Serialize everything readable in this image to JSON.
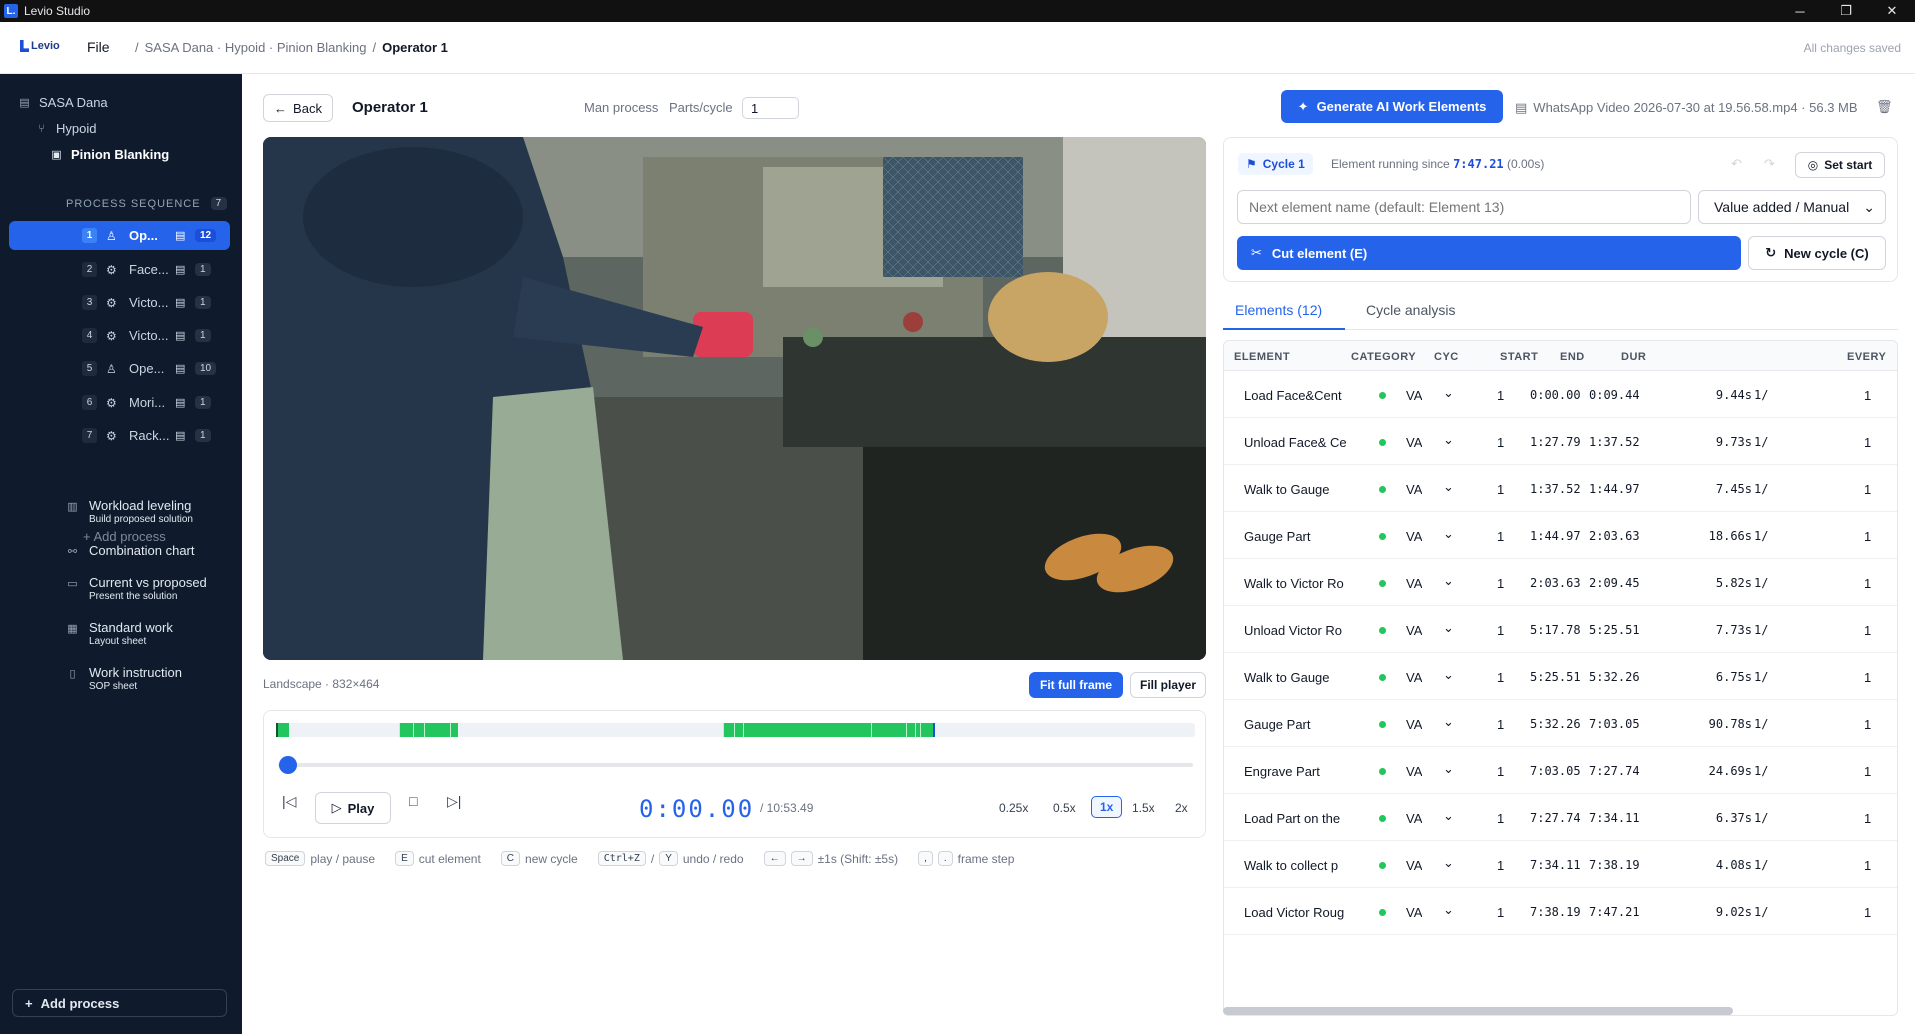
{
  "window": {
    "title": "Levio Studio",
    "app_icon": "L."
  },
  "header": {
    "logo": "Levio",
    "file_menu": "File",
    "breadcrumb": [
      "/",
      "SASA Dana · Hypoid · Pinion Blanking",
      "/",
      "Operator 1"
    ],
    "status": "All changes saved"
  },
  "sidebar": {
    "company": "SASA Dana",
    "product": "Hypoid",
    "line": "Pinion Blanking",
    "process_sequence_label": "PROCESS SEQUENCE",
    "process_count": "7",
    "processes": [
      {
        "num": "1",
        "name": "Op...",
        "type": "person",
        "count": "12",
        "active": true
      },
      {
        "num": "2",
        "name": "Face...",
        "type": "gear",
        "count": "1",
        "active": false
      },
      {
        "num": "3",
        "name": "Victo...",
        "type": "gear",
        "count": "1",
        "active": false
      },
      {
        "num": "4",
        "name": "Victo...",
        "type": "gear",
        "count": "1",
        "active": false
      },
      {
        "num": "5",
        "name": "Ope...",
        "type": "person",
        "count": "10",
        "active": false
      },
      {
        "num": "6",
        "name": "Mori...",
        "type": "gear",
        "count": "1",
        "active": false
      },
      {
        "num": "7",
        "name": "Rack...",
        "type": "gear",
        "count": "1",
        "active": false
      }
    ],
    "add_process_link": "+ Add process",
    "tools": [
      {
        "title": "Workload leveling",
        "subtitle": "Build proposed solution",
        "icon": "bar-chart-icon"
      },
      {
        "title": "Combination chart",
        "subtitle": "",
        "icon": "combination-icon"
      },
      {
        "title": "Current vs proposed",
        "subtitle": "Present the solution",
        "icon": "presentation-icon"
      },
      {
        "title": "Standard work",
        "subtitle": "Layout sheet",
        "icon": "layout-icon"
      },
      {
        "title": "Work instruction",
        "subtitle": "SOP sheet",
        "icon": "book-icon"
      }
    ],
    "add_process_button": "Add process"
  },
  "toolbar": {
    "back": "Back",
    "title": "Operator 1",
    "process_type": "Man process",
    "parts_label": "Parts/cycle",
    "parts_value": "1",
    "generate_button": "Generate AI Work Elements",
    "file_info": "WhatsApp Video 2026-07-30 at 19.56.58.mp4 · 56.3 MB"
  },
  "video": {
    "meta": "Landscape · 832×464",
    "fit_button": "Fit full frame",
    "fill_button": "Fill player"
  },
  "player": {
    "play_label": "Play",
    "current_time": "0:00.00",
    "total_time": "/ 10:53.49",
    "speeds": [
      "0.25x",
      "0.5x",
      "1x",
      "1.5x",
      "2x"
    ],
    "active_speed": "1x",
    "progress": 0.0
  },
  "shortcuts": [
    {
      "key": "Space",
      "desc": "play / pause"
    },
    {
      "key": "E",
      "desc": "cut element"
    },
    {
      "key": "C",
      "desc": "new cycle"
    },
    {
      "key": "Ctrl+Z",
      "sep": "/",
      "key2": "Y",
      "desc": "undo / redo"
    },
    {
      "key": "←",
      "key2": "→",
      "desc": "±1s (Shift: ±5s)"
    },
    {
      "key": ",",
      "key2": ".",
      "desc": "frame step"
    }
  ],
  "cycle_panel": {
    "cycle_label": "Cycle 1",
    "running_prefix": "Element running since",
    "running_time": "7:47.21",
    "running_suffix": "(0.00s)",
    "set_start": "Set start",
    "next_placeholder": "Next element name (default: Element 13)",
    "category_value": "Value added / Manual",
    "cut_button": "Cut element (E)",
    "new_cycle_button": "New cycle (C)"
  },
  "tabs": {
    "elements": "Elements (12)",
    "cycle_analysis": "Cycle analysis"
  },
  "table": {
    "headers": [
      "ELEMENT",
      "CATEGORY",
      "CYC",
      "START",
      "END",
      "DUR",
      "EVERY"
    ],
    "rows": [
      {
        "element": "Load Face&Cent",
        "cat": "VA",
        "cyc": "1",
        "start": "0:00.00",
        "end": "0:09.44",
        "dur": "9.44s",
        "frac": "1/",
        "every": "1"
      },
      {
        "element": "Unload Face& Ce",
        "cat": "VA",
        "cyc": "1",
        "start": "1:27.79",
        "end": "1:37.52",
        "dur": "9.73s",
        "frac": "1/",
        "every": "1"
      },
      {
        "element": "Walk to Gauge",
        "cat": "VA",
        "cyc": "1",
        "start": "1:37.52",
        "end": "1:44.97",
        "dur": "7.45s",
        "frac": "1/",
        "every": "1"
      },
      {
        "element": "Gauge Part",
        "cat": "VA",
        "cyc": "1",
        "start": "1:44.97",
        "end": "2:03.63",
        "dur": "18.66s",
        "frac": "1/",
        "every": "1"
      },
      {
        "element": "Walk to Victor Ro",
        "cat": "VA",
        "cyc": "1",
        "start": "2:03.63",
        "end": "2:09.45",
        "dur": "5.82s",
        "frac": "1/",
        "every": "1"
      },
      {
        "element": "Unload Victor Ro",
        "cat": "VA",
        "cyc": "1",
        "start": "5:17.78",
        "end": "5:25.51",
        "dur": "7.73s",
        "frac": "1/",
        "every": "1"
      },
      {
        "element": "Walk to Gauge",
        "cat": "VA",
        "cyc": "1",
        "start": "5:25.51",
        "end": "5:32.26",
        "dur": "6.75s",
        "frac": "1/",
        "every": "1"
      },
      {
        "element": "Gauge Part",
        "cat": "VA",
        "cyc": "1",
        "start": "5:32.26",
        "end": "7:03.05",
        "dur": "90.78s",
        "frac": "1/",
        "every": "1"
      },
      {
        "element": "Engrave Part",
        "cat": "VA",
        "cyc": "1",
        "start": "7:03.05",
        "end": "7:27.74",
        "dur": "24.69s",
        "frac": "1/",
        "every": "1"
      },
      {
        "element": "Load Part on the",
        "cat": "VA",
        "cyc": "1",
        "start": "7:27.74",
        "end": "7:34.11",
        "dur": "6.37s",
        "frac": "1/",
        "every": "1"
      },
      {
        "element": "Walk to collect p",
        "cat": "VA",
        "cyc": "1",
        "start": "7:34.11",
        "end": "7:38.19",
        "dur": "4.08s",
        "frac": "1/",
        "every": "1"
      },
      {
        "element": "Load Victor Roug",
        "cat": "VA",
        "cyc": "1",
        "start": "7:38.19",
        "end": "7:47.21",
        "dur": "9.02s",
        "frac": "1/",
        "every": "1"
      }
    ]
  },
  "colors": {
    "accent": "#2563eb",
    "sidebar_bg": "#0f1b2d",
    "va_green": "#22c55e"
  }
}
